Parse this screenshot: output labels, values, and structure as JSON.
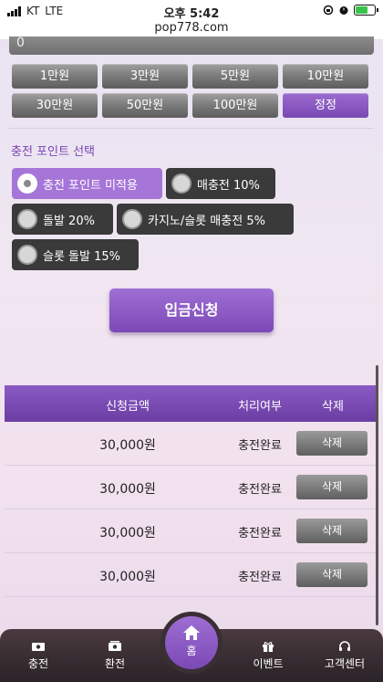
{
  "status_bar": {
    "carrier": "KT",
    "network": "LTE",
    "time": "오후 5:42",
    "url": "pop778.com"
  },
  "amount_input": {
    "value": "0"
  },
  "amount_buttons": [
    {
      "label": "1만원"
    },
    {
      "label": "3만원"
    },
    {
      "label": "5만원"
    },
    {
      "label": "10만원"
    },
    {
      "label": "30만원"
    },
    {
      "label": "50만원"
    },
    {
      "label": "100만원"
    },
    {
      "label": "정정"
    }
  ],
  "points": {
    "title": "충전 포인트 선택",
    "options": [
      {
        "label": "충전 포인트 미적용",
        "selected": true
      },
      {
        "label": "매충전 10%",
        "selected": false
      },
      {
        "label": "돌발 20%",
        "selected": false
      },
      {
        "label": "카지노/슬롯 매충전 5%",
        "selected": false
      },
      {
        "label": "슬롯 돌발 15%",
        "selected": false
      }
    ]
  },
  "deposit_button": {
    "label": "입금신청"
  },
  "table": {
    "headers": {
      "amount": "신청금액",
      "status": "처리여부",
      "delete": "삭제"
    },
    "rows": [
      {
        "amount": "30,000원",
        "status": "충전완료",
        "delete_label": "삭제"
      },
      {
        "amount": "30,000원",
        "status": "충전완료",
        "delete_label": "삭제"
      },
      {
        "amount": "30,000원",
        "status": "충전완료",
        "delete_label": "삭제"
      },
      {
        "amount": "30,000원",
        "status": "충전완료",
        "delete_label": "삭제"
      }
    ]
  },
  "bottom_nav": {
    "items": [
      {
        "label": "충전",
        "icon": "money-icon"
      },
      {
        "label": "환전",
        "icon": "exchange-money-icon"
      },
      {
        "label": "홈",
        "icon": "home-icon"
      },
      {
        "label": "이벤트",
        "icon": "gift-icon"
      },
      {
        "label": "고객센터",
        "icon": "headset-icon"
      }
    ]
  },
  "colors": {
    "accent": "#8a5ac4",
    "dark_button": "#3a3a3a",
    "selected_option": "#a675d8"
  }
}
